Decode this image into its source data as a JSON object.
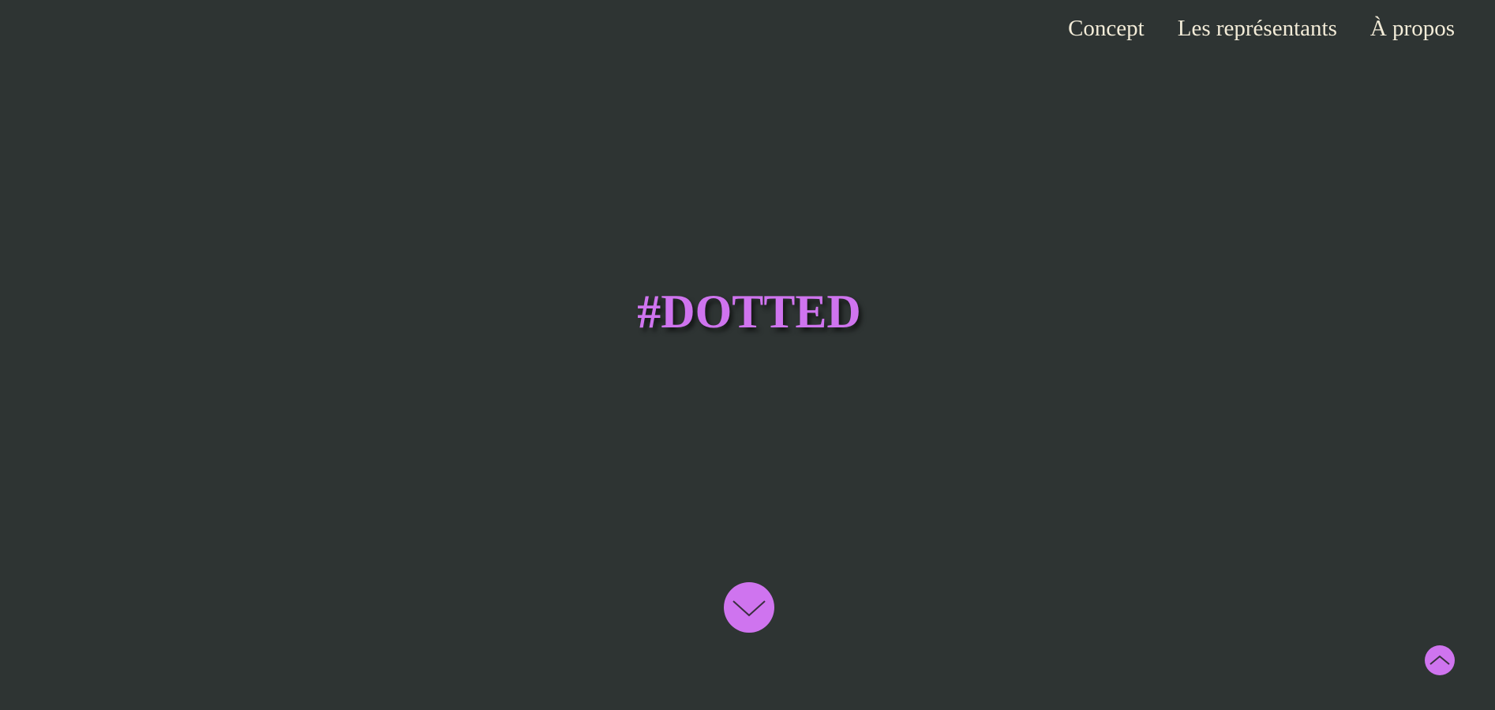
{
  "nav": {
    "items": [
      {
        "label": "Concept"
      },
      {
        "label": "Les représentants"
      },
      {
        "label": "À propos"
      }
    ]
  },
  "hero": {
    "title": "#DOTTED"
  },
  "colors": {
    "background": "#2e3433",
    "accent": "#cf74ef",
    "nav_text": "#f3ecd8",
    "icon_stroke": "#3a2f3f"
  },
  "icons": {
    "scroll_down": "chevron-down-icon",
    "back_to_top": "chevron-up-icon"
  }
}
